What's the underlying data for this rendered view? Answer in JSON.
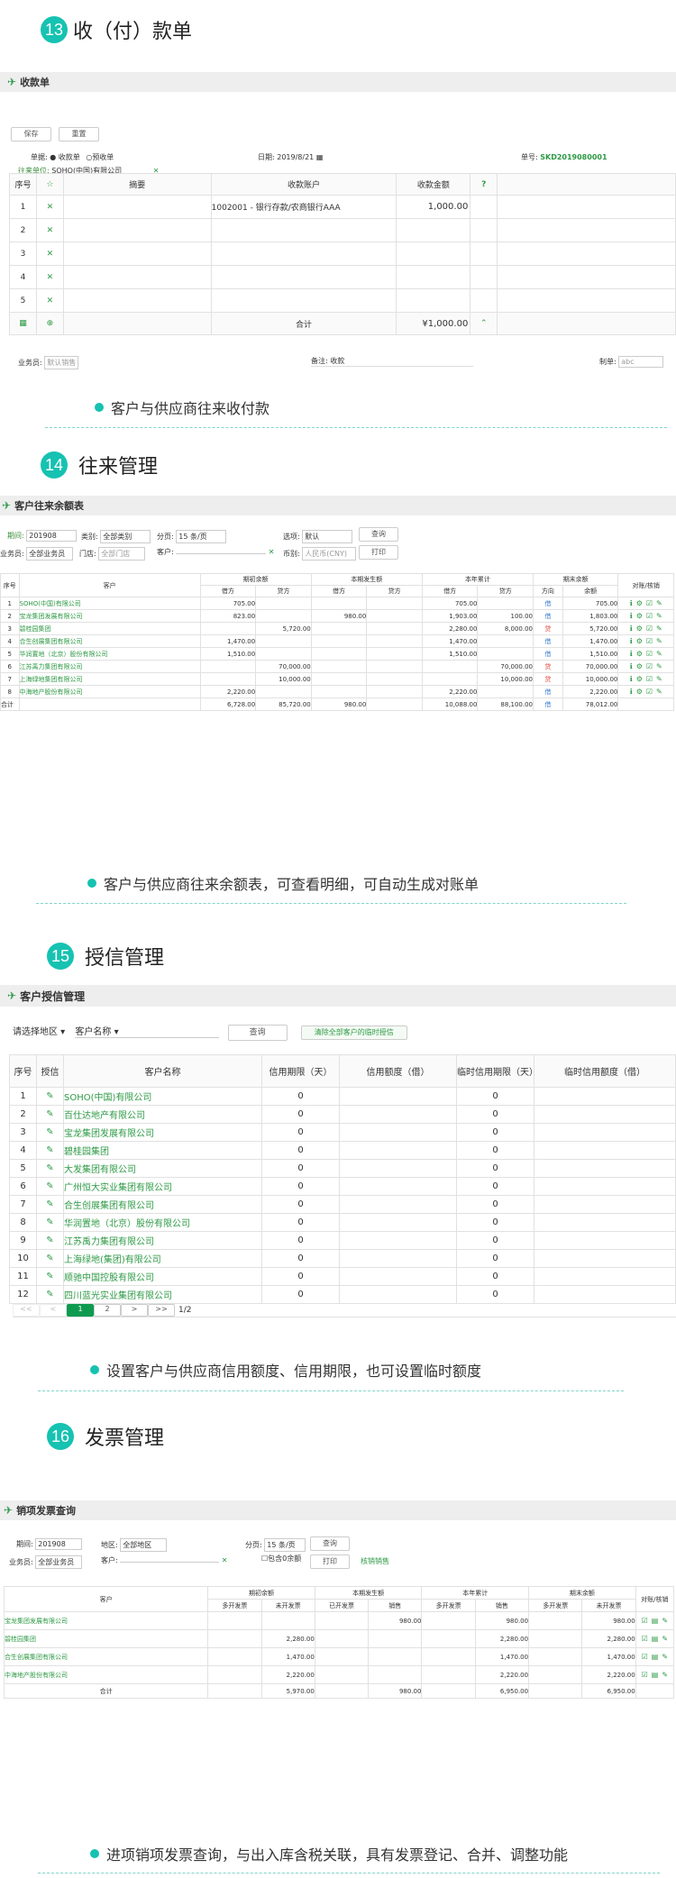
{
  "sections": [
    {
      "num": "13",
      "title": "收（付）款单"
    },
    {
      "num": "14",
      "title": "往来管理"
    },
    {
      "num": "15",
      "title": "授信管理"
    },
    {
      "num": "16",
      "title": "发票管理"
    }
  ],
  "receipt": {
    "panel_title": "收款单",
    "save": "保存",
    "reset": "重置",
    "doc_type_label": "单据:",
    "opt_receipt": "收款单",
    "opt_prepay": "预收单",
    "date_label": "日期:",
    "date_value": "2019/8/21",
    "no_label": "单号:",
    "no_value": "SKD2019080001",
    "party_label": "往来单位:",
    "party_value": "SOHO(中国)有限公司",
    "headers": [
      "序号",
      "摘要",
      "收款账户",
      "收款金额",
      "?"
    ],
    "rows": [
      {
        "no": "1",
        "summary": "",
        "account": "1002001 - 银行存款/农商银行AAA",
        "amount": "1,000.00"
      },
      {
        "no": "2",
        "summary": "",
        "account": "",
        "amount": ""
      },
      {
        "no": "3",
        "summary": "",
        "account": "",
        "amount": ""
      },
      {
        "no": "4",
        "summary": "",
        "account": "",
        "amount": ""
      },
      {
        "no": "5",
        "summary": "",
        "account": "",
        "amount": ""
      }
    ],
    "total_label": "合计",
    "total_value": "¥1,000.00",
    "sales_label": "业务员:",
    "sales_value": "默认销售",
    "remark_label": "备注:",
    "remark_value": "收款",
    "maker_label": "制单:",
    "maker_value": "abc"
  },
  "bullet13": "客户与供应商往来收付款",
  "balance": {
    "panel_title": "客户往来余额表",
    "f_period_label": "期间:",
    "f_period": "201908",
    "f_type_label": "类别:",
    "f_type": "全部类别",
    "f_page_label": "分页:",
    "f_page": "15 条/页",
    "f_opt_label": "选项:",
    "f_opt": "默认",
    "f_query": "查询",
    "f_sales_label": "业务员:",
    "f_sales": "全部业务员",
    "f_store_label": "门店:",
    "f_store": "全部门店",
    "f_cust_label": "客户:",
    "f_cur_label": "币别:",
    "f_cur": "人民币(CNY)",
    "f_print": "打印",
    "h_no": "序号",
    "h_cust": "客户",
    "h_open": "期初余额",
    "h_cur": "本期发生额",
    "h_year": "本年累计",
    "h_end": "期末余额",
    "h_act": "对账/核销",
    "h_debit": "借方",
    "h_credit": "贷方",
    "h_dir": "方向",
    "h_bal": "余额",
    "rows": [
      {
        "no": "1",
        "name": "SOHO(中国)有限公司",
        "od": "705.00",
        "oc": "",
        "cd": "",
        "cc": "",
        "yd": "705.00",
        "yc": "",
        "dir": "借",
        "bal": "705.00"
      },
      {
        "no": "2",
        "name": "宝龙集团发展有限公司",
        "od": "823.00",
        "oc": "",
        "cd": "980.00",
        "cc": "",
        "yd": "1,903.00",
        "yc": "100.00",
        "dir": "借",
        "bal": "1,803.00"
      },
      {
        "no": "3",
        "name": "碧桂园集团",
        "od": "",
        "oc": "5,720.00",
        "cd": "",
        "cc": "",
        "yd": "2,280.00",
        "yc": "8,000.00",
        "dir": "贷",
        "bal": "5,720.00"
      },
      {
        "no": "4",
        "name": "合生创展集团有限公司",
        "od": "1,470.00",
        "oc": "",
        "cd": "",
        "cc": "",
        "yd": "1,470.00",
        "yc": "",
        "dir": "借",
        "bal": "1,470.00"
      },
      {
        "no": "5",
        "name": "华润置地（北京）股份有限公司",
        "od": "1,510.00",
        "oc": "",
        "cd": "",
        "cc": "",
        "yd": "1,510.00",
        "yc": "",
        "dir": "借",
        "bal": "1,510.00"
      },
      {
        "no": "6",
        "name": "江苏禹力集团有限公司",
        "od": "",
        "oc": "70,000.00",
        "cd": "",
        "cc": "",
        "yd": "",
        "yc": "70,000.00",
        "dir": "贷",
        "bal": "70,000.00"
      },
      {
        "no": "7",
        "name": "上海绿地集团有限公司",
        "od": "",
        "oc": "10,000.00",
        "cd": "",
        "cc": "",
        "yd": "",
        "yc": "10,000.00",
        "dir": "贷",
        "bal": "10,000.00"
      },
      {
        "no": "8",
        "name": "中海地产股份有限公司",
        "od": "2,220.00",
        "oc": "",
        "cd": "",
        "cc": "",
        "yd": "2,220.00",
        "yc": "",
        "dir": "借",
        "bal": "2,220.00"
      }
    ],
    "total": {
      "label": "合计",
      "od": "6,728.00",
      "oc": "85,720.00",
      "cd": "980.00",
      "cc": "",
      "yd": "10,088.00",
      "yc": "88,100.00",
      "dir": "借",
      "bal": "78,012.00"
    }
  },
  "bullet14": "客户与供应商往来余额表，可查看明细，可自动生成对账单",
  "credit": {
    "panel_title": "客户授信管理",
    "region": "请选择地区",
    "cust_name": "客户名称",
    "query": "查询",
    "clear_btn": "清除全部客户的临时授信",
    "headers": [
      "序号",
      "授信",
      "客户名称",
      "信用期限（天）",
      "信用额度（借）",
      "临时信用期限（天）",
      "临时信用额度（借）"
    ],
    "rows": [
      {
        "no": "1",
        "name": "SOHO(中国)有限公司",
        "term": "0",
        "temp": "0"
      },
      {
        "no": "2",
        "name": "百仕达地产有限公司",
        "term": "0",
        "temp": "0"
      },
      {
        "no": "3",
        "name": "宝龙集团发展有限公司",
        "term": "0",
        "temp": "0"
      },
      {
        "no": "4",
        "name": "碧桂园集团",
        "term": "0",
        "temp": "0"
      },
      {
        "no": "5",
        "name": "大发集团有限公司",
        "term": "0",
        "temp": "0"
      },
      {
        "no": "6",
        "name": "广州恒大实业集团有限公司",
        "term": "0",
        "temp": "0"
      },
      {
        "no": "7",
        "name": "合生创展集团有限公司",
        "term": "0",
        "temp": "0"
      },
      {
        "no": "8",
        "name": "华润置地（北京）股份有限公司",
        "term": "0",
        "temp": "0"
      },
      {
        "no": "9",
        "name": "江苏禹力集团有限公司",
        "term": "0",
        "temp": "0"
      },
      {
        "no": "10",
        "name": "上海绿地(集团)有限公司",
        "term": "0",
        "temp": "0"
      },
      {
        "no": "11",
        "name": "顺驰中国控股有限公司",
        "term": "0",
        "temp": "0"
      },
      {
        "no": "12",
        "name": "四川蓝光实业集团有限公司",
        "term": "0",
        "temp": "0"
      }
    ],
    "pager": {
      "first": "<<",
      "prev": "<",
      "p1": "1",
      "p2": "2",
      "next": ">",
      "last": ">>",
      "info": "1/2"
    }
  },
  "bullet15": "设置客户与供应商信用额度、信用期限，也可设置临时额度",
  "invoice": {
    "panel_title": "销项发票查询",
    "period_label": "期间:",
    "period": "201908",
    "area_label": "地区:",
    "area": "全部地区",
    "page_label": "分页:",
    "page": "15 条/页",
    "query": "查询",
    "sales_label": "业务员:",
    "sales": "全部业务员",
    "cust_label": "客户:",
    "zero_label": "包含0余额",
    "print": "打印",
    "verify": "核销销售",
    "h_cust": "客户",
    "h_open": "期初余额",
    "h_cur": "本期发生额",
    "h_year": "本年累计",
    "h_end": "期末余额",
    "h_act": "对账/核销",
    "h_over": "多开发票",
    "h_notopen": "未开发票",
    "h_opened": "已开发票",
    "h_sale": "销售",
    "rows": [
      {
        "name": "宝龙集团发展有限公司",
        "a": "",
        "b": "",
        "c": "",
        "d": "980.00",
        "e": "",
        "f": "980.00",
        "g": "",
        "h": "980.00"
      },
      {
        "name": "碧桂园集团",
        "a": "",
        "b": "2,280.00",
        "c": "",
        "d": "",
        "e": "",
        "f": "2,280.00",
        "g": "",
        "h": "2,280.00"
      },
      {
        "name": "合生创展集团有限公司",
        "a": "",
        "b": "1,470.00",
        "c": "",
        "d": "",
        "e": "",
        "f": "1,470.00",
        "g": "",
        "h": "1,470.00"
      },
      {
        "name": "中海地产股份有限公司",
        "a": "",
        "b": "2,220.00",
        "c": "",
        "d": "",
        "e": "",
        "f": "2,220.00",
        "g": "",
        "h": "2,220.00"
      }
    ],
    "total": {
      "label": "合计",
      "a": "",
      "b": "5,970.00",
      "c": "",
      "d": "980.00",
      "e": "",
      "f": "6,950.00",
      "g": "",
      "h": "6,950.00"
    }
  },
  "bullet16": "进项销项发票查询，与出入库含税关联，具有发票登记、合并、调整功能",
  "colors": {
    "accent": "#16c2b1",
    "green": "#2d9a45",
    "debit": "#3d7fd1",
    "credit": "#e0483c"
  }
}
